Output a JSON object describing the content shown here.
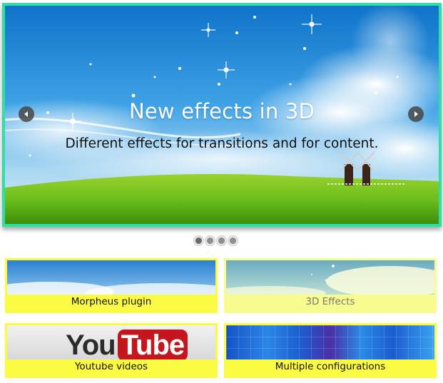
{
  "slide": {
    "title": "New effects in 3D",
    "subtitle": "Different effects for transitions and for content."
  },
  "pager": {
    "count": 4,
    "active_index": 0
  },
  "thumbnails": [
    {
      "label": "Morpheus plugin"
    },
    {
      "label": "3D Effects"
    },
    {
      "label": "Youtube videos",
      "logo_text_left": "You",
      "logo_text_right": "Tube"
    },
    {
      "label": "Multiple configurations"
    }
  ],
  "colors": {
    "slider_border": "#2de0a6",
    "thumb_bg": "#fbfb44",
    "thumb_bg_active": "#f8fb8e"
  },
  "icons": {
    "prev": "arrow-left-icon",
    "next": "arrow-right-icon"
  }
}
